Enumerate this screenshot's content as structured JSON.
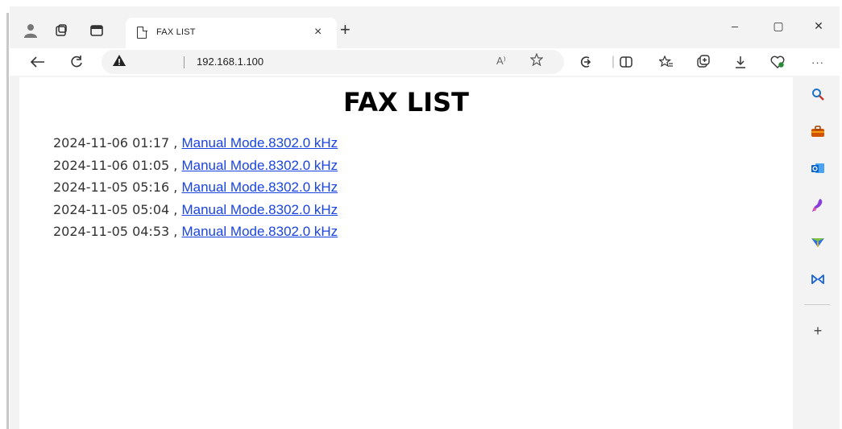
{
  "browser": {
    "tab_title": "FAX LIST",
    "tab_close": "×",
    "new_tab": "+",
    "window_controls": {
      "minimize": "–",
      "maximize": "▢",
      "close": "✕"
    },
    "url": "192.168.1.100",
    "read_aloud": "A⁾",
    "icons": [
      "profile-icon",
      "workspaces-icon",
      "tab-actions-icon",
      "page-icon",
      "back-icon",
      "refresh-icon",
      "warning-icon",
      "read-aloud-icon",
      "favorite-icon",
      "copilot-icon",
      "split-screen-icon",
      "favorites-icon",
      "collections-icon",
      "downloads-icon",
      "browser-essentials-icon",
      "more-icon"
    ]
  },
  "page": {
    "title": "FAX LIST",
    "entries": [
      {
        "timestamp": "2024-11-06 01:17",
        "separator": " , ",
        "link": "Manual Mode.8302.0 kHz"
      },
      {
        "timestamp": "2024-11-06 01:05",
        "separator": " , ",
        "link": "Manual Mode.8302.0 kHz"
      },
      {
        "timestamp": "2024-11-05 05:16",
        "separator": " , ",
        "link": "Manual Mode.8302.0 kHz"
      },
      {
        "timestamp": "2024-11-05 05:04",
        "separator": " , ",
        "link": "Manual Mode.8302.0 kHz"
      },
      {
        "timestamp": "2024-11-05 04:53",
        "separator": " , ",
        "link": "Manual Mode.8302.0 kHz"
      }
    ]
  },
  "sidebar": {
    "add": "+",
    "icons": [
      "search-icon",
      "tools-icon",
      "outlook-icon",
      "designer-icon",
      "drop-icon",
      "games-icon"
    ],
    "colors": {
      "search": "#1a73c8",
      "tools": "#d35400",
      "outlook": "#0a64c8",
      "designer": "#8a3ddb",
      "drop": "#2e6fe0",
      "games": "#1a64d0"
    }
  }
}
